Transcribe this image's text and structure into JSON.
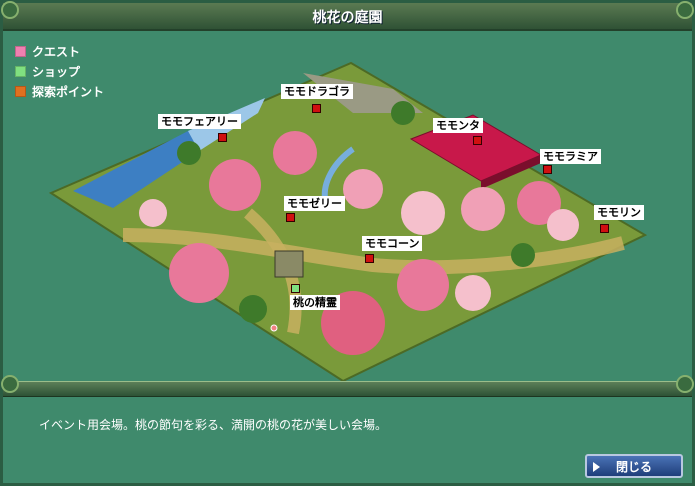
{
  "window": {
    "title": "桃花の庭園"
  },
  "legend": [
    {
      "label": "クエスト",
      "color": "#f080b0"
    },
    {
      "label": "ショップ",
      "color": "#80e080"
    },
    {
      "label": "探索ポイント",
      "color": "#e07020"
    }
  ],
  "pois": [
    {
      "label": "モモドラゴラ",
      "type": "quest"
    },
    {
      "label": "モモフェアリー",
      "type": "quest"
    },
    {
      "label": "モモンタ",
      "type": "quest"
    },
    {
      "label": "モモラミア",
      "type": "quest"
    },
    {
      "label": "モモゼリー",
      "type": "quest"
    },
    {
      "label": "モモリン",
      "type": "quest"
    },
    {
      "label": "モモコーン",
      "type": "quest"
    },
    {
      "label": "桃の精霊",
      "type": "shop"
    }
  ],
  "colors": {
    "quest_marker": "#d01010",
    "shop_marker": "#80e080"
  },
  "description": "イベント用会場。桃の節句を彩る、満開の桃の花が美しい会場。",
  "close_label": "閉じる"
}
